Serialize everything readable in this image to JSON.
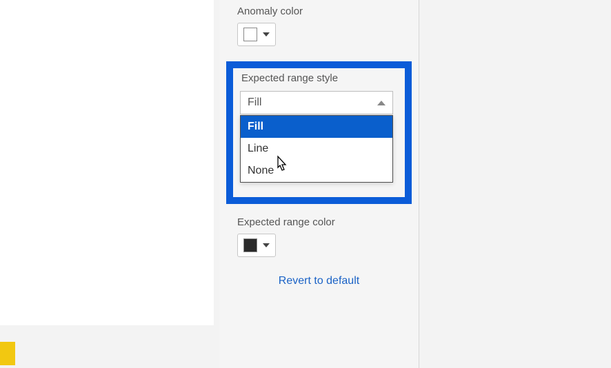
{
  "anomaly": {
    "label": "Anomaly color",
    "color": "#ffffff"
  },
  "expectedStyle": {
    "label": "Expected range style",
    "selected": "Fill",
    "options": [
      "Fill",
      "Line",
      "None"
    ]
  },
  "expectedColor": {
    "label": "Expected range color",
    "color": "#2a2a2a"
  },
  "revert": {
    "label": "Revert to default"
  }
}
